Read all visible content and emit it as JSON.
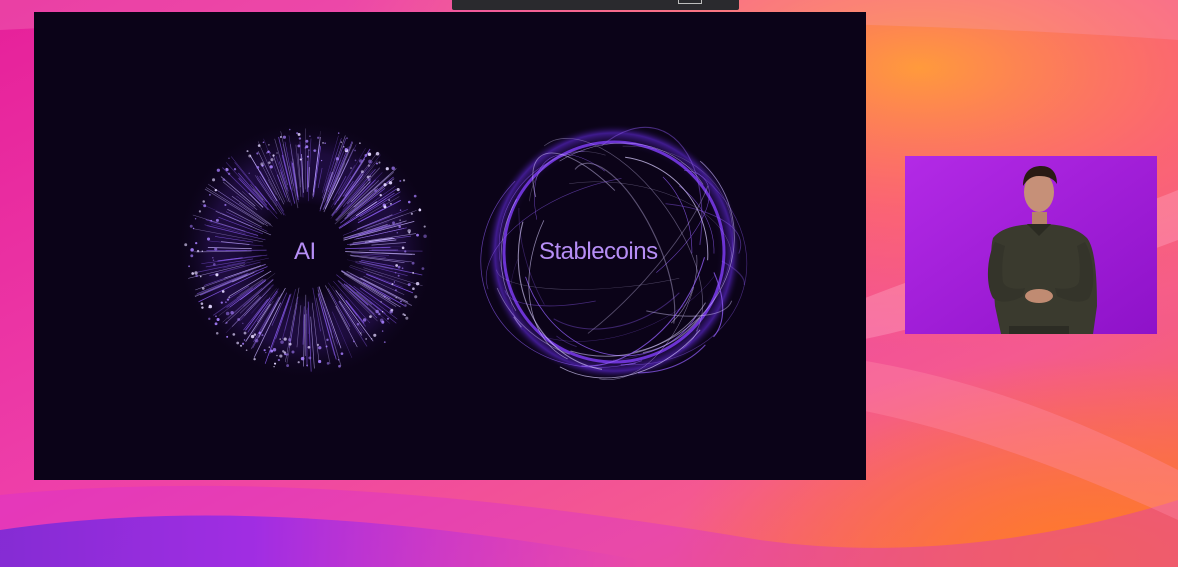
{
  "slide": {
    "labels": {
      "ai": "AI",
      "stablecoins": "Stablecoins"
    }
  },
  "icons": {
    "ai_visual": "particle-burst-icon",
    "stablecoins_visual": "orbit-globe-icon",
    "presenter": "presenter-video"
  },
  "colors": {
    "slide_background": "#0b0318",
    "label_color": "#b68ef5",
    "accent_purple": "#7b3bf0",
    "presenter_background": "#a21ed9"
  }
}
